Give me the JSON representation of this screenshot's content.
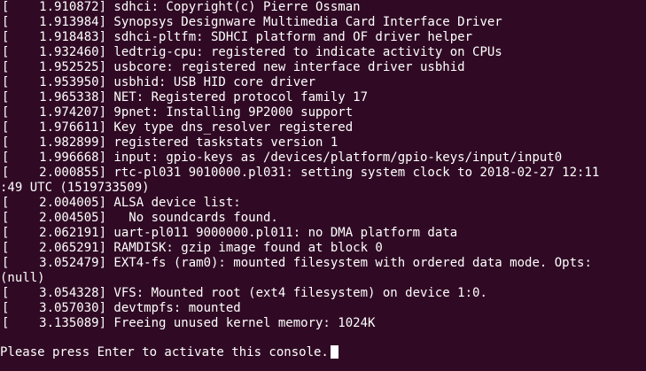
{
  "theme": {
    "background": "#300a24",
    "foreground": "#ffffff"
  },
  "terminal": {
    "lines": [
      "[    1.910872] sdhci: Copyright(c) Pierre Ossman",
      "[    1.913984] Synopsys Designware Multimedia Card Interface Driver",
      "[    1.918483] sdhci-pltfm: SDHCI platform and OF driver helper",
      "[    1.932460] ledtrig-cpu: registered to indicate activity on CPUs",
      "[    1.952525] usbcore: registered new interface driver usbhid",
      "[    1.953950] usbhid: USB HID core driver",
      "[    1.965338] NET: Registered protocol family 17",
      "[    1.974207] 9pnet: Installing 9P2000 support",
      "[    1.976611] Key type dns_resolver registered",
      "[    1.982899] registered taskstats version 1",
      "[    1.996668] input: gpio-keys as /devices/platform/gpio-keys/input/input0",
      "[    2.000855] rtc-pl031 9010000.pl031: setting system clock to 2018-02-27 12:11",
      ":49 UTC (1519733509)",
      "[    2.004005] ALSA device list:",
      "[    2.004505]   No soundcards found.",
      "[    2.062191] uart-pl011 9000000.pl011: no DMA platform data",
      "[    2.065291] RAMDISK: gzip image found at block 0",
      "[    3.052479] EXT4-fs (ram0): mounted filesystem with ordered data mode. Opts:",
      "(null)",
      "[    3.054328] VFS: Mounted root (ext4 filesystem) on device 1:0.",
      "[    3.057030] devtmpfs: mounted",
      "[    3.135089] Freeing unused kernel memory: 1024K",
      "",
      "Please press Enter to activate this console."
    ]
  }
}
